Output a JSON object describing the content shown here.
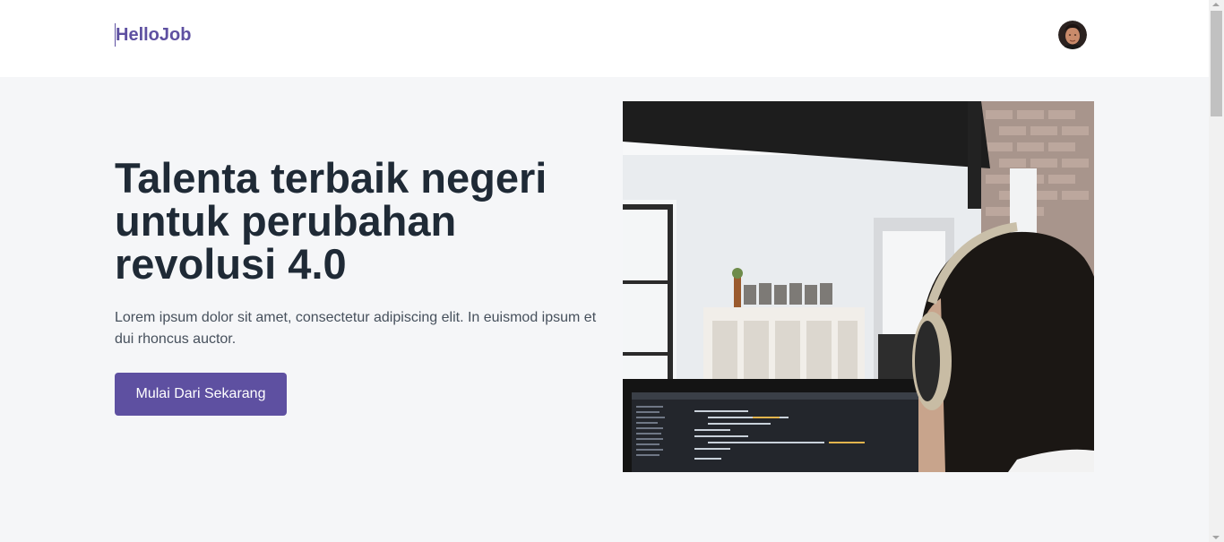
{
  "navbar": {
    "logo": "HelloJob",
    "avatar_icon": "user-avatar-icon"
  },
  "hero": {
    "title": "Talenta terbaik negeri untuk perubahan revolusi 4.0",
    "description": "Lorem ipsum dolor sit amet, consectetur adipiscing elit. In euismod ipsum et dui rhoncus auctor.",
    "cta_label": "Mulai Dari Sekarang",
    "image_icon": "developer-at-desk-photo"
  },
  "colors": {
    "brand": "#5e50a1",
    "heading": "#1f2a36",
    "body_text": "#46505c",
    "page_background": "#f5f6f8",
    "navbar_background": "#ffffff"
  }
}
